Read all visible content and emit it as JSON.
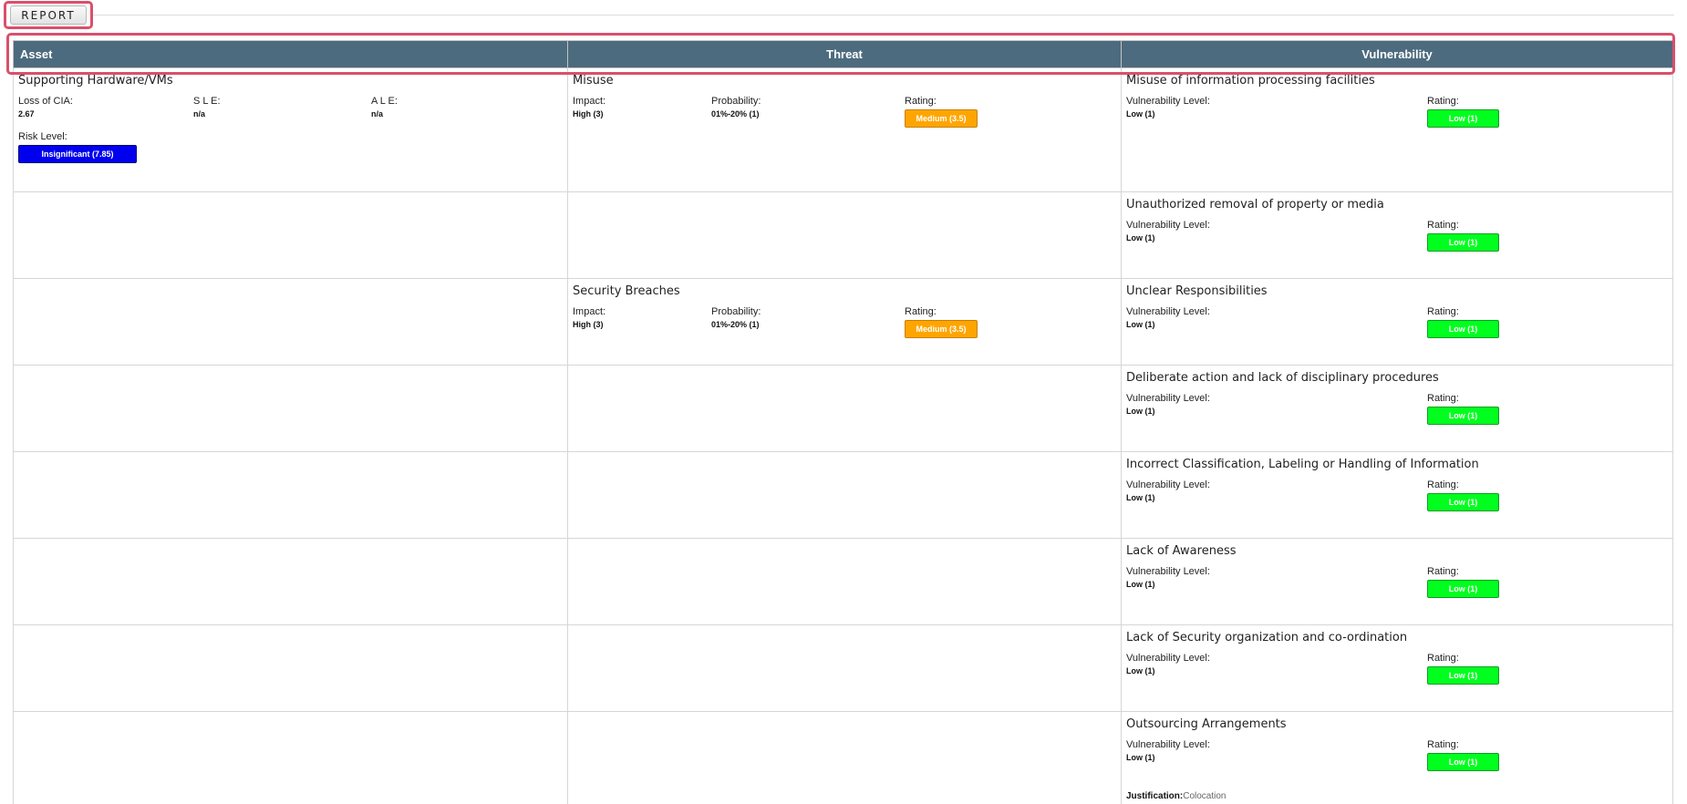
{
  "toolbar": {
    "report_label": "REPORT"
  },
  "table": {
    "headers": {
      "asset": "Asset",
      "threat": "Threat",
      "vulnerability": "Vulnerability"
    },
    "labels": {
      "loss_of_cia": "Loss of CIA:",
      "sle": "S L E:",
      "ale": "A L E:",
      "risk_level": "Risk Level:",
      "impact": "Impact:",
      "probability": "Probability:",
      "rating": "Rating:",
      "vulnerability_level": "Vulnerability Level:",
      "justification": "Justification:"
    },
    "asset": {
      "name": "Supporting Hardware/VMs",
      "loss_of_cia": "2.67",
      "sle": "n/a",
      "ale": "n/a",
      "risk_level": "Insignificant (7.85)",
      "risk_color": "#0000ee"
    },
    "threats": [
      {
        "name": "Misuse",
        "impact": "High (3)",
        "probability": "01%-20% (1)",
        "rating": "Medium (3.5)",
        "rating_color": "#ffa500"
      },
      {
        "name": "Security Breaches",
        "impact": "High (3)",
        "probability": "01%-20% (1)",
        "rating": "Medium (3.5)",
        "rating_color": "#ffa500"
      }
    ],
    "vulnerabilities": [
      {
        "name": "Misuse of information processing facilities",
        "level": "Low (1)",
        "rating": "Low (1)"
      },
      {
        "name": "Unauthorized removal of property or media",
        "level": "Low (1)",
        "rating": "Low (1)"
      },
      {
        "name": "Unclear Responsibilities",
        "level": "Low (1)",
        "rating": "Low (1)"
      },
      {
        "name": "Deliberate action and lack of disciplinary procedures",
        "level": "Low (1)",
        "rating": "Low (1)"
      },
      {
        "name": "Incorrect Classification, Labeling or Handling of Information",
        "level": "Low (1)",
        "rating": "Low (1)"
      },
      {
        "name": "Lack of Awareness",
        "level": "Low (1)",
        "rating": "Low (1)"
      },
      {
        "name": "Lack of Security organization and co-ordination",
        "level": "Low (1)",
        "rating": "Low (1)"
      },
      {
        "name": "Outsourcing Arrangements",
        "level": "Low (1)",
        "rating": "Low (1)",
        "justification": "Colocation"
      }
    ],
    "rating_low_color": "#00ff1f",
    "header_color": "#4d6b7e",
    "highlight_color": "#d9506b"
  }
}
